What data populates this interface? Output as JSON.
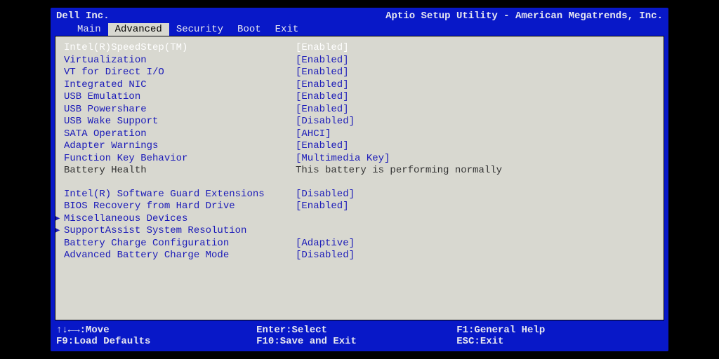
{
  "header": {
    "vendor": "Dell Inc.",
    "utility": "Aptio Setup Utility - American Megatrends, Inc."
  },
  "tabs": [
    "Main",
    "Advanced",
    "Security",
    "Boot",
    "Exit"
  ],
  "active_tab_index": 1,
  "settings_group1": [
    {
      "label": "Intel(R)SpeedStep(TM)",
      "value": "[Enabled]",
      "selected": true
    },
    {
      "label": "Virtualization",
      "value": "[Enabled]"
    },
    {
      "label": "VT for Direct I/O",
      "value": "[Enabled]"
    },
    {
      "label": "Integrated NIC",
      "value": "[Enabled]"
    },
    {
      "label": "USB Emulation",
      "value": "[Enabled]"
    },
    {
      "label": "USB Powershare",
      "value": "[Enabled]"
    },
    {
      "label": "USB Wake Support",
      "value": "[Disabled]"
    },
    {
      "label": "SATA Operation",
      "value": "[AHCI]"
    },
    {
      "label": "Adapter Warnings",
      "value": "[Enabled]"
    },
    {
      "label": "Function Key Behavior",
      "value": "[Multimedia Key]"
    },
    {
      "label": "Battery Health",
      "value": "This battery is performing normally",
      "plain": true
    }
  ],
  "settings_group2": [
    {
      "label": "Intel(R) Software Guard Extensions",
      "value": "[Disabled]"
    },
    {
      "label": "BIOS Recovery from Hard Drive",
      "value": "[Enabled]"
    },
    {
      "label": "Miscellaneous Devices",
      "value": "",
      "submenu": true
    },
    {
      "label": "SupportAssist System Resolution",
      "value": "",
      "submenu": true
    },
    {
      "label": "Battery Charge Configuration",
      "value": "[Adaptive]"
    },
    {
      "label": "Advanced Battery Charge Mode",
      "value": "[Disabled]"
    }
  ],
  "footer": {
    "row1": {
      "left": "↑↓←→:Move",
      "mid": "Enter:Select",
      "right": "F1:General Help"
    },
    "row2": {
      "left": "F9:Load Defaults",
      "mid": "F10:Save and Exit",
      "right": "ESC:Exit"
    }
  }
}
